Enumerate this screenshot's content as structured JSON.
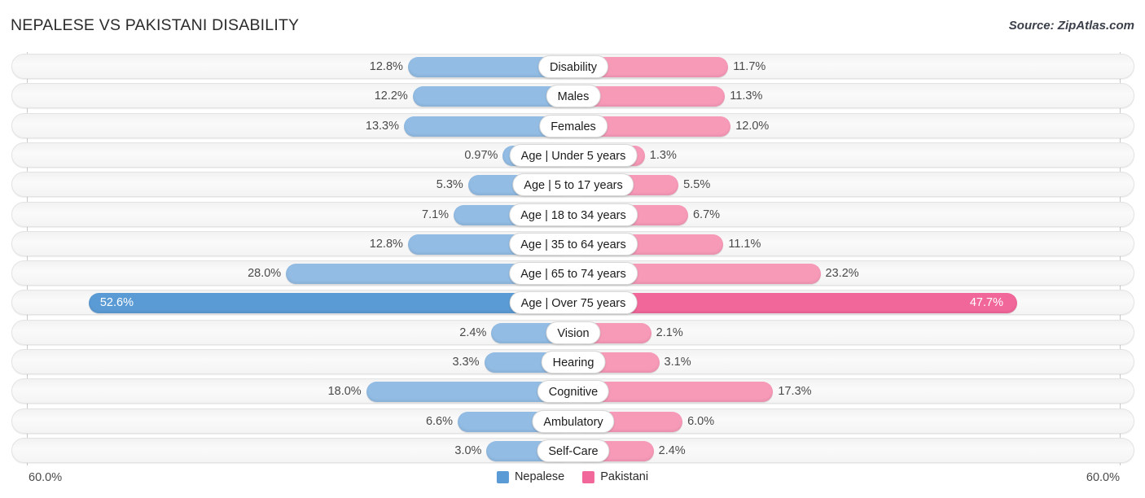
{
  "header": {
    "title": "NEPALESE VS PAKISTANI DISABILITY",
    "source": "Source: ZipAtlas.com"
  },
  "axis": {
    "left_label": "60.0%",
    "right_label": "60.0%",
    "max": 60.0
  },
  "legend": {
    "items": [
      {
        "label": "Nepalese",
        "color": "#5b9bd5"
      },
      {
        "label": "Pakistani",
        "color": "#f2679a"
      }
    ]
  },
  "colors": {
    "left_bar": "#92bce4",
    "right_bar": "#f79ab8",
    "left_bar_highlight": "#5b9bd5",
    "right_bar_highlight": "#f2679a",
    "row_background": "#f5f5f5",
    "gridline": "#c8c8c8"
  },
  "chart_data": {
    "type": "bar",
    "title": "NEPALESE VS PAKISTANI DISABILITY",
    "subtitle": "Source: ZipAtlas.com",
    "orientation": "horizontal-diverging",
    "xlabel": "",
    "ylabel": "",
    "xlim": [
      -60.0,
      60.0
    ],
    "axis_tick_labels": [
      "60.0%",
      "60.0%"
    ],
    "grid": true,
    "legend_position": "bottom-center",
    "categories": [
      "Disability",
      "Males",
      "Females",
      "Age | Under 5 years",
      "Age | 5 to 17 years",
      "Age | 18 to 34 years",
      "Age | 35 to 64 years",
      "Age | 65 to 74 years",
      "Age | Over 75 years",
      "Vision",
      "Hearing",
      "Cognitive",
      "Ambulatory",
      "Self-Care"
    ],
    "series": [
      {
        "name": "Nepalese",
        "color": "#92bce4",
        "values": [
          12.8,
          12.2,
          13.3,
          0.97,
          5.3,
          7.1,
          12.8,
          28.0,
          52.6,
          2.4,
          3.3,
          18.0,
          6.6,
          3.0
        ],
        "labels": [
          "12.8%",
          "12.2%",
          "13.3%",
          "0.97%",
          "5.3%",
          "7.1%",
          "12.8%",
          "28.0%",
          "52.6%",
          "2.4%",
          "3.3%",
          "18.0%",
          "6.6%",
          "3.0%"
        ]
      },
      {
        "name": "Pakistani",
        "color": "#f79ab8",
        "values": [
          11.7,
          11.3,
          12.0,
          1.3,
          5.5,
          6.7,
          11.1,
          23.2,
          47.7,
          2.1,
          3.1,
          17.3,
          6.0,
          2.4
        ],
        "labels": [
          "11.7%",
          "11.3%",
          "12.0%",
          "1.3%",
          "5.5%",
          "6.7%",
          "11.1%",
          "23.2%",
          "47.7%",
          "2.1%",
          "3.1%",
          "17.3%",
          "6.0%",
          "2.4%"
        ]
      }
    ],
    "highlighted_row": "Age | Over 75 years"
  }
}
